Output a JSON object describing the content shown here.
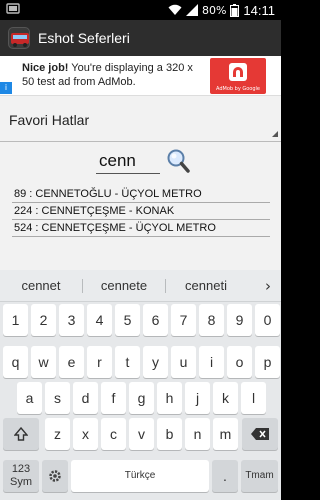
{
  "status": {
    "battery_text": "80%",
    "time": "14:11",
    "icons": [
      "notification-icon",
      "wifi-icon",
      "signal-icon",
      "battery-icon"
    ]
  },
  "actionbar": {
    "title": "Eshot Seferleri",
    "icon": "bus-app-icon"
  },
  "ad": {
    "text_bold": "Nice job!",
    "text_rest": " You're displaying a 320 x 50 test ad from AdMob.",
    "brand": "AdMob by Google",
    "info_glyph": "i"
  },
  "main": {
    "spinner_label": "Favori Hatlar",
    "search_value": "cenn",
    "results": [
      "89 : CENNETOĞLU - ÜÇYOL METRO",
      "224 : CENNETÇEŞME - KONAK",
      "524 : CENNETÇEŞME - ÜÇYOL METRO"
    ]
  },
  "keyboard": {
    "suggestions": [
      "cennet",
      "cennete",
      "cenneti"
    ],
    "more": "›",
    "row_numbers": [
      "1",
      "2",
      "3",
      "4",
      "5",
      "6",
      "7",
      "8",
      "9",
      "0"
    ],
    "row1": [
      "q",
      "w",
      "e",
      "r",
      "t",
      "y",
      "u",
      "i",
      "o",
      "p"
    ],
    "row2": [
      "a",
      "s",
      "d",
      "f",
      "g",
      "h",
      "j",
      "k",
      "l"
    ],
    "row3": [
      "z",
      "x",
      "c",
      "v",
      "b",
      "n",
      "m"
    ],
    "sym_label_1": "123",
    "sym_label_2": "Sym",
    "space_label": "Türkçe",
    "enter_label": "Tmam"
  }
}
